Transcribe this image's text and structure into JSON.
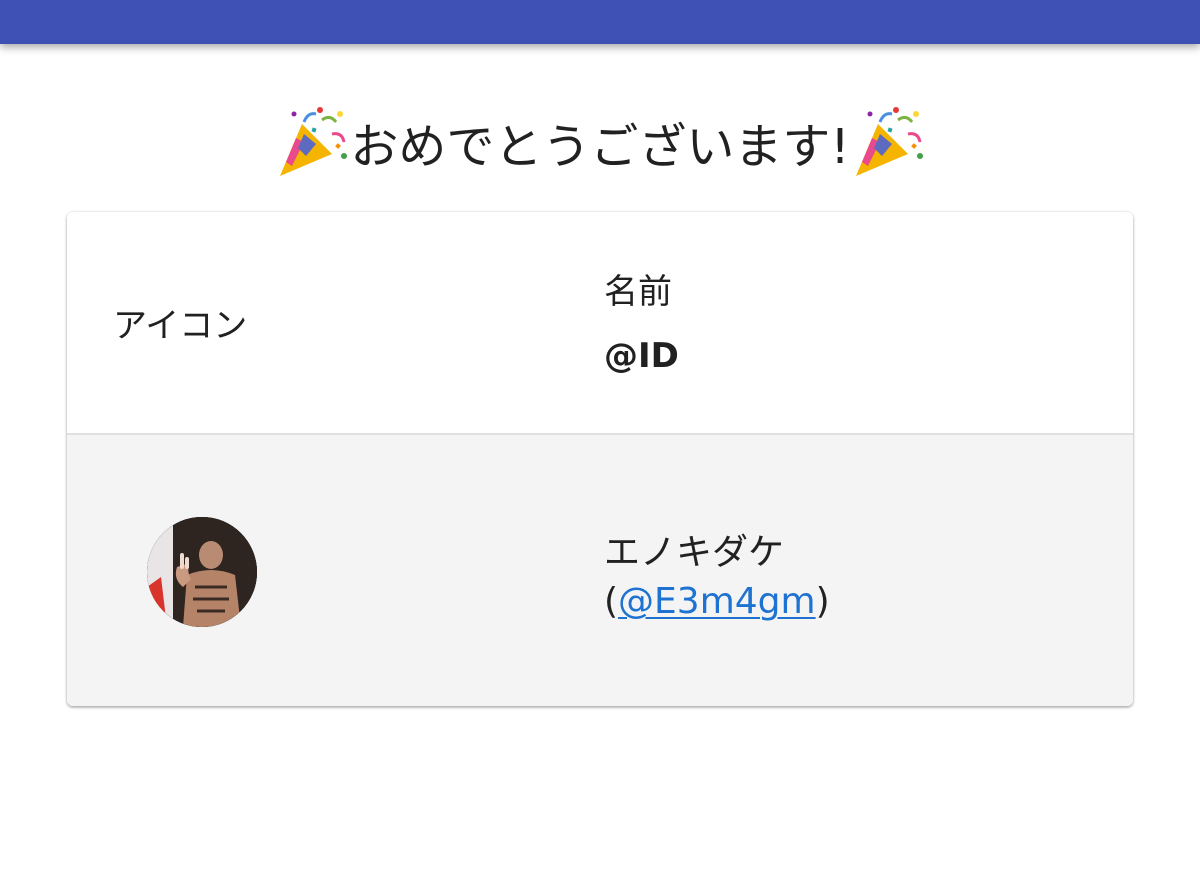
{
  "title": {
    "text": "おめでとうございます!",
    "left_icon": "party-popper-icon",
    "right_icon": "party-popper-icon"
  },
  "table": {
    "header": {
      "icon_label": "アイコン",
      "name_label": "名前",
      "id_label": "@ID"
    },
    "rows": [
      {
        "avatar": "user-avatar",
        "name": "エノキダケ",
        "id_open": "(",
        "id_link": "@E3m4gm",
        "id_close": ")"
      }
    ]
  },
  "colors": {
    "app_bar": "#3f51b5",
    "link": "#1e73d2",
    "row_background": "#f4f4f4"
  }
}
